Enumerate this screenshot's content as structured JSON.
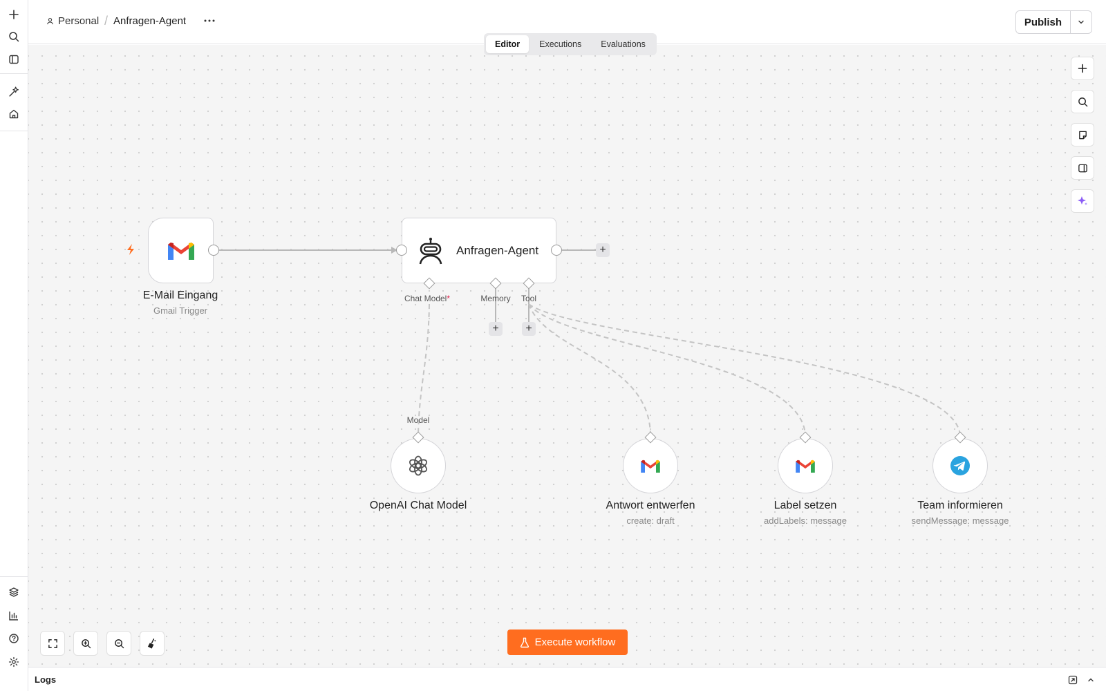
{
  "header": {
    "project": "Personal",
    "separator": "/",
    "workflow_name": "Anfragen-Agent",
    "publish_label": "Publish"
  },
  "tabs": [
    {
      "label": "Editor",
      "active": true
    },
    {
      "label": "Executions",
      "active": false
    },
    {
      "label": "Evaluations",
      "active": false
    }
  ],
  "nodes": {
    "trigger": {
      "title": "E-Mail Eingang",
      "subtitle": "Gmail Trigger",
      "icon": "gmail-icon"
    },
    "agent": {
      "title": "Anfragen-Agent",
      "icon": "robot-icon"
    },
    "chat_model": {
      "title": "OpenAI Chat Model",
      "icon": "openai-icon"
    },
    "draft": {
      "title": "Antwort entwerfen",
      "subtitle": "create: draft",
      "icon": "gmail-icon"
    },
    "label": {
      "title": "Label setzen",
      "subtitle": "addLabels: message",
      "icon": "gmail-icon"
    },
    "telegram": {
      "title": "Team informieren",
      "subtitle": "sendMessage: message",
      "icon": "telegram-icon"
    }
  },
  "ports": {
    "chat_model": "Chat Model",
    "required_mark": "*",
    "memory": "Memory",
    "tool": "Tool",
    "model": "Model"
  },
  "execute_label": "Execute workflow",
  "logs_label": "Logs",
  "colors": {
    "accent": "#ff6d1f",
    "canvas": "#f5f5f5",
    "required": "#e11d48",
    "telegram": "#2aa3df",
    "ai_sparkle": "#8b5cf6"
  }
}
